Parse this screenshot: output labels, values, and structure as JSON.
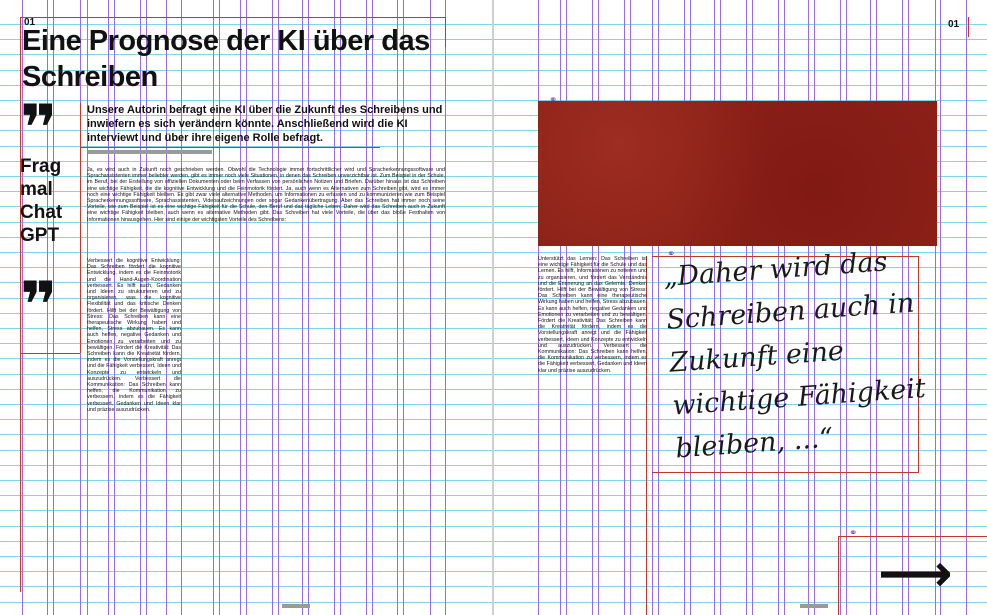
{
  "spread": {
    "left_page_number": "01",
    "right_page_number": "01"
  },
  "article": {
    "title": "Eine Prognose der KI über das Schreiben",
    "lede": "Unsere Autorin befragt eine KI über die Zukunft des Schreibens und inwiefern es sich verändern könnte. Anschließend wird die KI interviewt und über ihre eigene Rolle befragt.",
    "side_label": [
      "Frag",
      "mal",
      "Chat",
      "GPT"
    ],
    "quote_open": "❞",
    "quote_close": "❞",
    "intro_text": "Ja, es wird auch in Zukunft noch geschrieben werden. Obwohl die Technologie immer fortschrittlicher wird und Spracherkennungssoftware und Sprachassistenten immer beliebter werden, gibt es immer noch viele Situationen, in denen das Schreiben unverzichtbar ist. Zum Beispiel in der Schule, im Beruf, bei der Erstellung von offiziellen Dokumenten oder beim Verfassen von persönlichen Notizen und Briefen. Darüber hinaus ist das Schreiben eine wichtige Fähigkeit, die die kognitive Entwicklung und die Feinmotorik fördert. Ja, auch wenn es Alternativen zum Schreiben gibt, wird es immer noch eine wichtige Fähigkeit bleiben. Es gibt zwar viele alternative Methoden, um Informationen zu erfassen und zu kommunizieren wie zum Beispiel Spracherkennungssoftware, Sprachassistenten, Videoaufzeichnungen oder sogar Gedankenübertragung. Aber das Schreiben hat immer noch seine Vorteile, wie zum Beispiel ist es eine wichtige Fähigkeit für die Schule, den Beruf und das tägliche Leben. Daher wird das Schreiben auch in Zukunft eine wichtige Fähigkeit bleiben, auch wenn es alternative Methoden gibt. Das Schreiben hat viele Vorteile, die über das bloße Festhalten von Informationen hinausgehen. Hier sind einige der wichtigsten Vorteile des Schreibens:",
    "column_left_text": "Verbessert die kognitive Entwicklung: Das Schreiben fördert die kognitive Entwicklung, indem es die Feinmotorik und die Hand-Augen-Koordination verbessert. Es hilft auch, Gedanken und Ideen zu strukturieren und zu organisieren, was die kognitive Flexibilität und das kritische Denken fördert. Hilft bei der Bewältigung von Stress: Das Schreiben kann eine therapeutische Wirkung haben und helfen, Stress abzubauen. Es kann auch helfen, negative Gedanken und Emotionen zu verarbeiten und zu bewältigen. Fördert die Kreativität: Das Schreiben kann die Kreativität fördern, indem es die Vorstellungskraft anregt und die Fähigkeit verbessert, Ideen und Konzepte zu entwickeln und auszudrücken. Verbessert die Kommunikation: Das Schreiben kann helfen, die Kommunikation zu verbessern, indem es die Fähigkeit verbessert, Gedanken und Ideen klar und präzise auszudrücken.",
    "column_right_text": "Unterstützt das Lernen: Das Schreiben ist eine wichtige Fähigkeit für die Schule und das Lernen. Es hilft, Informationen zu notieren und zu organisieren, und fördert das Verständnis und die Erinnerung an das Gelernte. Denken fördert. Hilft bei der Bewältigung von Stress: Das Schreiben kann eine therapeutische Wirkung haben und helfen, Stress abzubauen. Es kann auch helfen, negative Gedanken und Emotionen zu verarbeiten und zu bewältigen. Fördert die Kreativität: Das Schreiben kann die Kreativität fördern, indem es die Vorstellungskraft anregt und die Fähigkeit verbessert, Ideen und Konzepte zu entwickeln und auszudrücken. Verbessert die Kommunikation: Das Schreiben kann helfen, die Kommunikation zu verbessern, indem es die Fähigkeit verbessert, Gedanken und Ideen klar und präzise auszudrücken.",
    "handwritten_quote": "„Daher wird das Schreiben auch in Zukunft eine wichtige Fähigkeit bleiben, ...“",
    "arrow_glyph": "⟶"
  },
  "colors": {
    "guide_horizontal": "#7fd6e6",
    "guide_vertical": "#9b6be0",
    "frame_red": "#c0392b",
    "photo_red": "#8b2018"
  }
}
